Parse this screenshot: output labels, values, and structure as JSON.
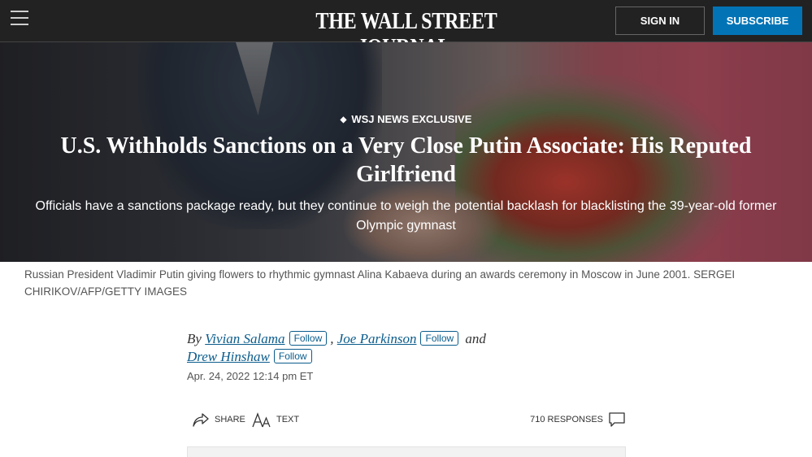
{
  "header": {
    "logo": "THE WALL STREET JOURNAL.",
    "sign_in": "SIGN IN",
    "subscribe": "SUBSCRIBE"
  },
  "article": {
    "kicker": "WSJ NEWS EXCLUSIVE",
    "headline": "U.S. Withholds Sanctions on a Very Close Putin Associate: His Reputed Girlfriend",
    "dek": "Officials have a sanctions package ready, but they continue to weigh the potential backlash for blacklisting the 39-year-old former Olympic gymnast",
    "caption": "Russian President Vladimir Putin giving flowers to rhythmic gymnast Alina Kabaeva during an awards ceremony in Moscow in June 2001. SERGEI CHIRIKOV/AFP/GETTY IMAGES"
  },
  "byline": {
    "prefix": "By",
    "authors": [
      "Vivian Salama",
      "Joe Parkinson",
      "Drew Hinshaw"
    ],
    "follow_label": "Follow",
    "separator": ",",
    "and_word": "and",
    "date": "Apr. 24, 2022 12:14 pm ET"
  },
  "toolbar": {
    "share": "SHARE",
    "text": "TEXT",
    "responses": "710 RESPONSES"
  },
  "icons": [
    "hamburger-icon",
    "share-icon",
    "text-size-icon",
    "comment-icon"
  ]
}
